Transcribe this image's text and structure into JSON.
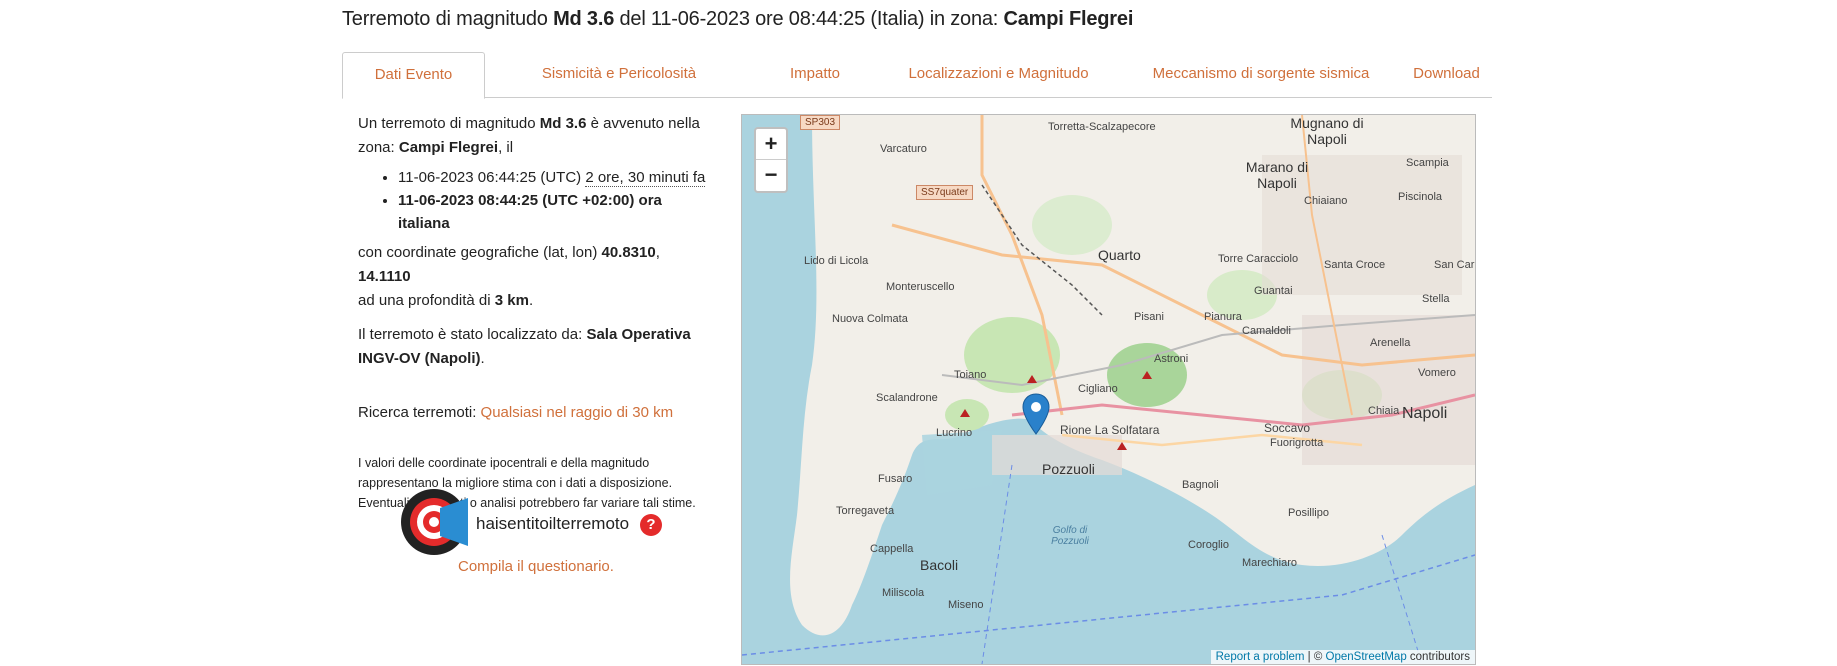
{
  "header": {
    "prefix": "Terremoto di magnitudo ",
    "magnitude": "Md 3.6",
    "mid": " del 11-06-2023 ore 08:44:25 (Italia) in zona: ",
    "zone": "Campi Flegrei"
  },
  "tabs": [
    {
      "label": "Dati Evento"
    },
    {
      "label": "Sismicità e Pericolosità"
    },
    {
      "label": "Impatto"
    },
    {
      "label": "Localizzazioni e Magnitudo"
    },
    {
      "label": "Meccanismo di sorgente sismica"
    },
    {
      "label": "Download"
    }
  ],
  "event": {
    "intro1": "Un terremoto di magnitudo ",
    "magnitude": "Md 3.6",
    "intro2": " è avvenuto nella zona: ",
    "zone": "Campi Flegrei",
    "intro3": ", il",
    "utc_time": "11-06-2023 06:44:25 (UTC) ",
    "ago": "2 ore, 30 minuti fa",
    "local_time": "11-06-2023 08:44:25 (UTC +02:00) ora italiana",
    "coord_text": "con coordinate geografiche (lat, lon) ",
    "lat": "40.8310",
    "lon": "14.1110",
    "depth_text1": "ad una profondità di ",
    "depth": "3 km",
    "loc_text": "Il terremoto è stato localizzato da: ",
    "loc_by": "Sala Operativa INGV-OV (Napoli)",
    "search_label": "Ricerca terremoti: ",
    "search_link": "Qualsiasi nel raggio di 30 km",
    "disclaimer": "I valori delle coordinate ipocentrali e della magnitudo rappresentano la migliore stima con i dati a disposizione. Eventuali nuovi dati o analisi potrebbero far variare tali stime."
  },
  "hsit": {
    "logo": "haisentitoilterremoto",
    "help": "?",
    "cta": "Compila il questionario."
  },
  "map": {
    "zoom_in": "+",
    "zoom_out": "−",
    "attr_report": "Report a problem",
    "attr_sep": " | © ",
    "attr_osm": "OpenStreetMap",
    "attr_contrib": " contributors",
    "labels": {
      "napoli": "Napoli",
      "pozzuoli": "Pozzuoli",
      "quarto": "Quarto",
      "mugnano": "Mugnano di Napoli",
      "marano": "Marano di Napoli",
      "bacoli": "Bacoli",
      "soccavo": "Soccavo",
      "agnano": "Rione La Solfatara",
      "posillipo": "Posillipo",
      "fuorigrotta": "Fuorigrotta",
      "arenella": "Arenella",
      "vomero": "Vomero",
      "chiaia": "Chiaia",
      "monteruscello": "Monteruscello",
      "licola": "Lido di Licola",
      "varcaturo": "Varcaturo",
      "capellaniscia": "Cappella",
      "miseno": "Miseno",
      "torregaveta": "Torregaveta",
      "fusaro": "Fusaro",
      "lucrino": "Lucrino",
      "toiano": "Toiano",
      "pisani": "Pisani",
      "pianura": "Pianura",
      "camaldoli": "Camaldoli",
      "chiaiano": "Chiaiano",
      "scampia": "Scampia",
      "piscinola": "Piscinola",
      "sancarlo": "San Carlo",
      "stella": "Stella",
      "marechiaro": "Marechiaro",
      "coroglio": "Coroglio",
      "bagnoli": "Bagnoli",
      "cigliano": "Cigliano",
      "astroni": "Astroni",
      "nuovacolmata": "Nuova Colmata",
      "scalandrone": "Scalandrone",
      "miliscola": "Miliscola",
      "guantai": "Guantai",
      "torrecaracciolo": "Torre Caracciolo",
      "santacroce": "Santa Croce",
      "torretta": "Torretta-Scalzapecore",
      "golfo": "Golfo di Pozzuoli",
      "ss7": "SS7quater",
      "sp303": "SP303"
    }
  },
  "colors": {
    "accent": "#d0703b",
    "sea": "#aad3df",
    "land": "#f2efe9",
    "park": "#c8e6b4",
    "marker": "#2a81cb"
  }
}
